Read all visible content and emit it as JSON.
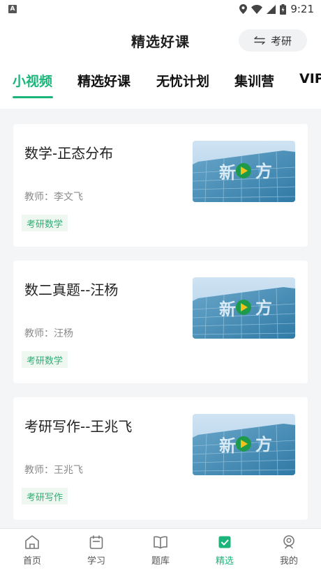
{
  "status": {
    "time": "9:21",
    "icon_a": "A"
  },
  "header": {
    "title": "精选好课",
    "switch_label": "考研"
  },
  "tabs": [
    "小视频",
    "精选好课",
    "无忧计划",
    "集训营",
    "VIP"
  ],
  "cards": [
    {
      "title": "数学-正态分布",
      "teacher": "教师：李文飞",
      "tag": "考研数学"
    },
    {
      "title": "数二真题--汪杨",
      "teacher": "教师：汪杨",
      "tag": "考研数学"
    },
    {
      "title": "考研写作--王兆飞",
      "teacher": "教师：王兆飞",
      "tag": "考研写作"
    }
  ],
  "nav": [
    {
      "label": "首页",
      "icon": "home-icon"
    },
    {
      "label": "学习",
      "icon": "calendar-icon"
    },
    {
      "label": "题库",
      "icon": "book-icon"
    },
    {
      "label": "精选",
      "icon": "check-icon"
    },
    {
      "label": "我的",
      "icon": "profile-icon"
    }
  ],
  "colors": {
    "accent": "#1bb57a",
    "background": "#f4f5f7"
  }
}
